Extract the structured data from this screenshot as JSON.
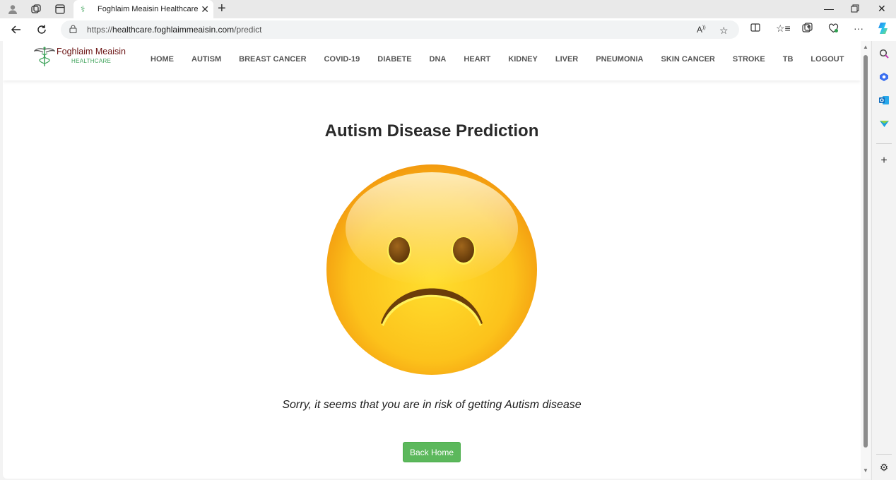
{
  "browser": {
    "tab_title": "Foghlaim Meaisin Healthcare",
    "url_scheme": "https://",
    "url_host": "healthcare.foghlaimmeaisin.com",
    "url_path": "/predict"
  },
  "site": {
    "logo_name": "Foghlaim Meaisin",
    "logo_sub": "HEALTHCARE",
    "menu": [
      "HOME",
      "AUTISM",
      "BREAST CANCER",
      "COVID-19",
      "DIABETE",
      "DNA",
      "HEART",
      "KIDNEY",
      "LIVER",
      "PNEUMONIA",
      "SKIN CANCER",
      "STROKE",
      "TB",
      "LOGOUT"
    ]
  },
  "content": {
    "title": "Autism Disease Prediction",
    "result_icon": "sad-face-emoji",
    "message": "Sorry, it seems that you are in risk of getting Autism disease",
    "back_button": "Back Home"
  },
  "colors": {
    "button": "#5cb85c",
    "logo_name": "#6b1414",
    "logo_sub": "#3fa35b"
  }
}
